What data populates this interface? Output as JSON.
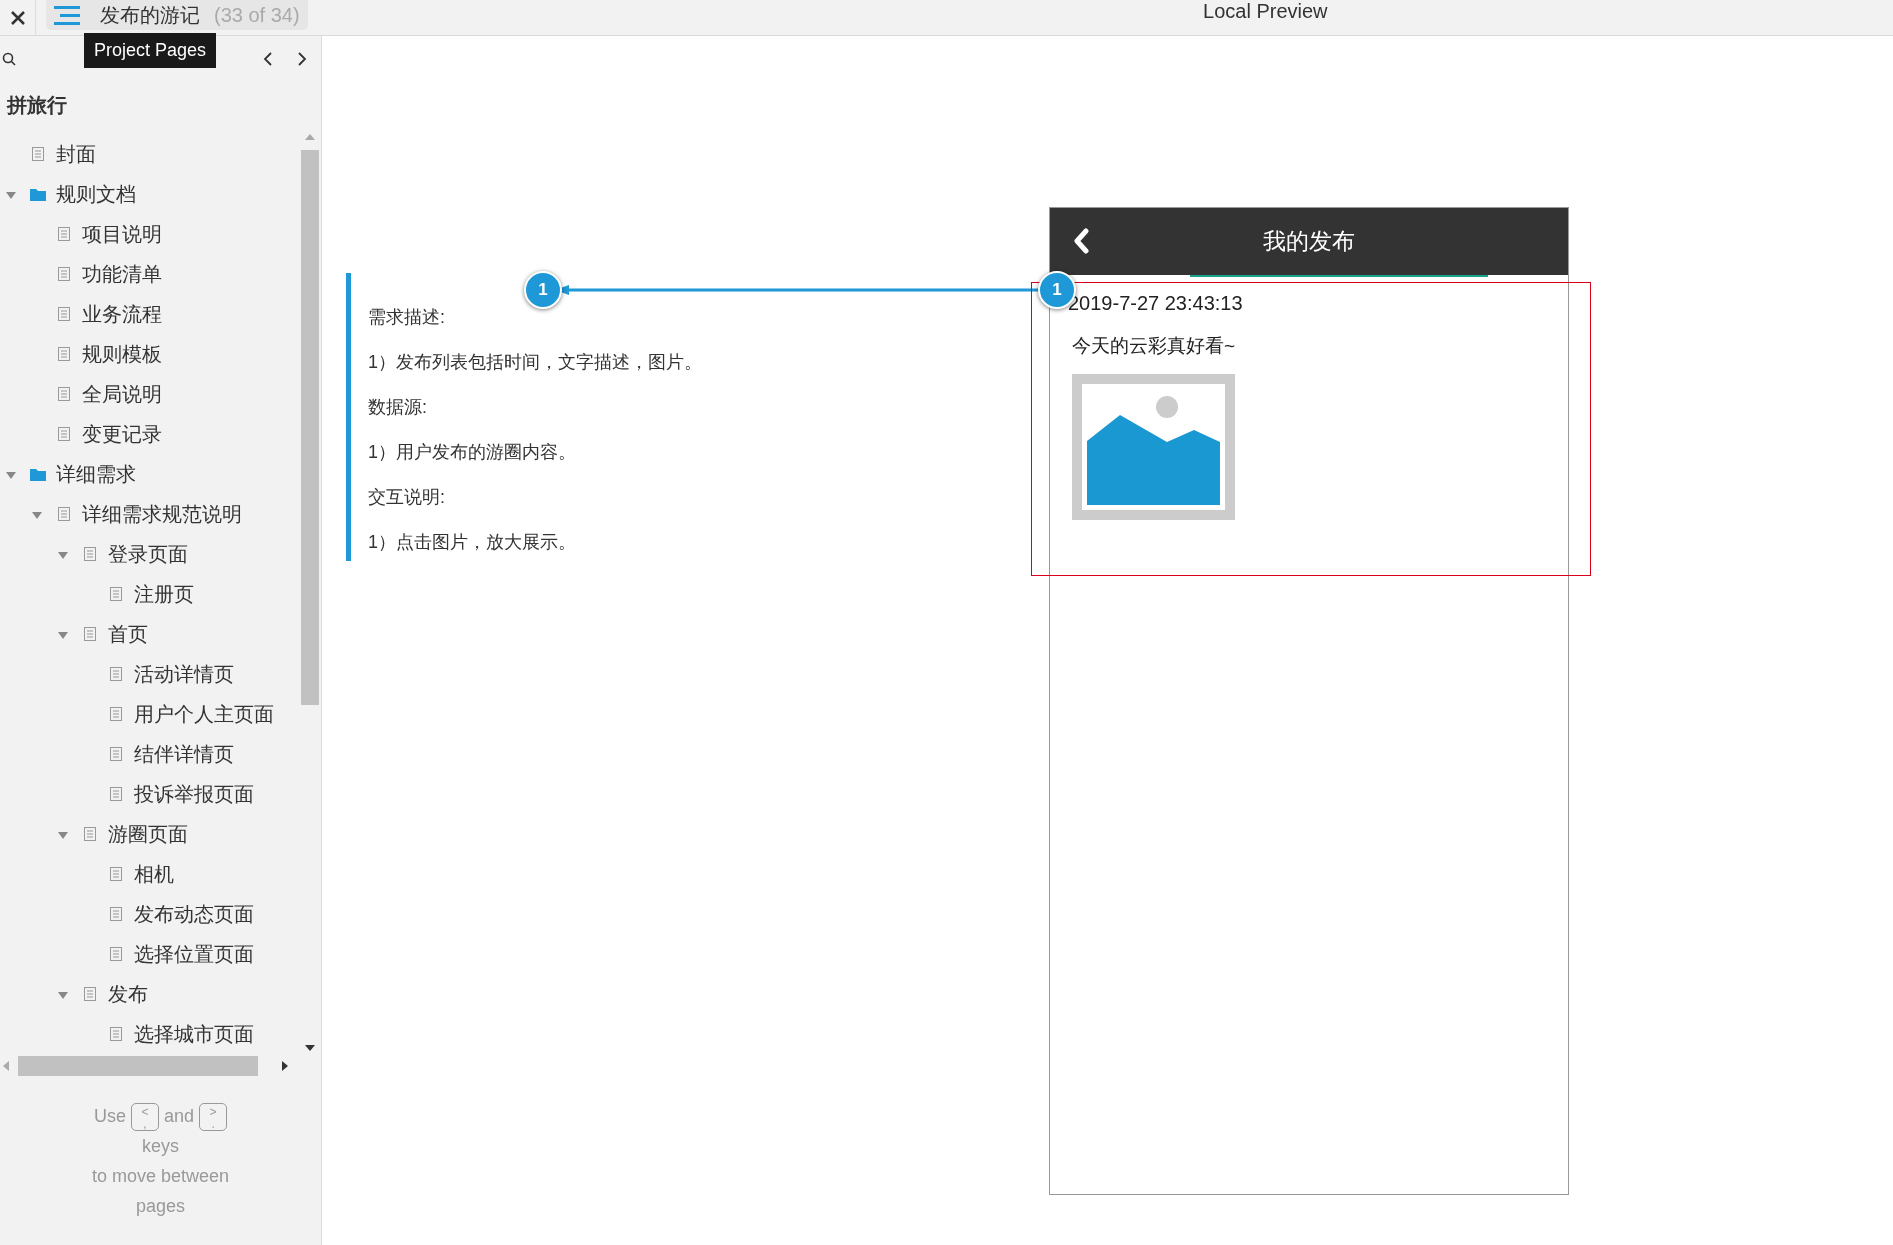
{
  "toolbar": {
    "page_title": "发布的游记",
    "page_count": "(33 of 34)",
    "preview_title": "Local Preview"
  },
  "tooltip": "Project Pages",
  "sidebar": {
    "project": "拼旅行",
    "tree": [
      {
        "label": "封面",
        "kind": "page"
      },
      {
        "label": "规则文档",
        "kind": "folder",
        "expanded": true,
        "children": [
          {
            "label": "项目说明",
            "kind": "page"
          },
          {
            "label": "功能清单",
            "kind": "page"
          },
          {
            "label": "业务流程",
            "kind": "page"
          },
          {
            "label": "规则模板",
            "kind": "page"
          },
          {
            "label": "全局说明",
            "kind": "page"
          },
          {
            "label": "变更记录",
            "kind": "page"
          }
        ]
      },
      {
        "label": "详细需求",
        "kind": "folder",
        "expanded": true,
        "children": [
          {
            "label": "详细需求规范说明",
            "kind": "page",
            "expanded": true,
            "children": [
              {
                "label": "登录页面",
                "kind": "page",
                "expanded": true,
                "children": [
                  {
                    "label": "注册页",
                    "kind": "page"
                  }
                ]
              },
              {
                "label": "首页",
                "kind": "page",
                "expanded": true,
                "children": [
                  {
                    "label": "活动详情页",
                    "kind": "page"
                  },
                  {
                    "label": "用户个人主页面",
                    "kind": "page"
                  },
                  {
                    "label": "结伴详情页",
                    "kind": "page"
                  },
                  {
                    "label": "投诉举报页面",
                    "kind": "page"
                  }
                ]
              },
              {
                "label": "游圈页面",
                "kind": "page",
                "expanded": true,
                "children": [
                  {
                    "label": "相机",
                    "kind": "page"
                  },
                  {
                    "label": "发布动态页面",
                    "kind": "page"
                  },
                  {
                    "label": "选择位置页面",
                    "kind": "page"
                  }
                ]
              },
              {
                "label": "发布",
                "kind": "page",
                "expanded": true,
                "children": [
                  {
                    "label": "选择城市页面",
                    "kind": "page"
                  }
                ]
              }
            ]
          }
        ]
      }
    ],
    "hint": {
      "use": "Use",
      "key_prev": {
        "top": "<",
        "bottom": ","
      },
      "and": "and",
      "key_next": {
        "top": ">",
        "bottom": "."
      },
      "lines": [
        "keys",
        "to move between",
        "pages"
      ]
    }
  },
  "annotation": {
    "marker": "1",
    "lines": [
      "需求描述:",
      "1）发布列表包括时间，文字描述，图片。",
      "数据源:",
      "1）用户发布的游圈内容。",
      "交互说明:",
      "1）点击图片，放大展示。"
    ]
  },
  "phone": {
    "title": "我的发布",
    "marker": "1",
    "post": {
      "time": "2019-7-27 23:43:13",
      "text": "今天的云彩真好看~"
    }
  }
}
